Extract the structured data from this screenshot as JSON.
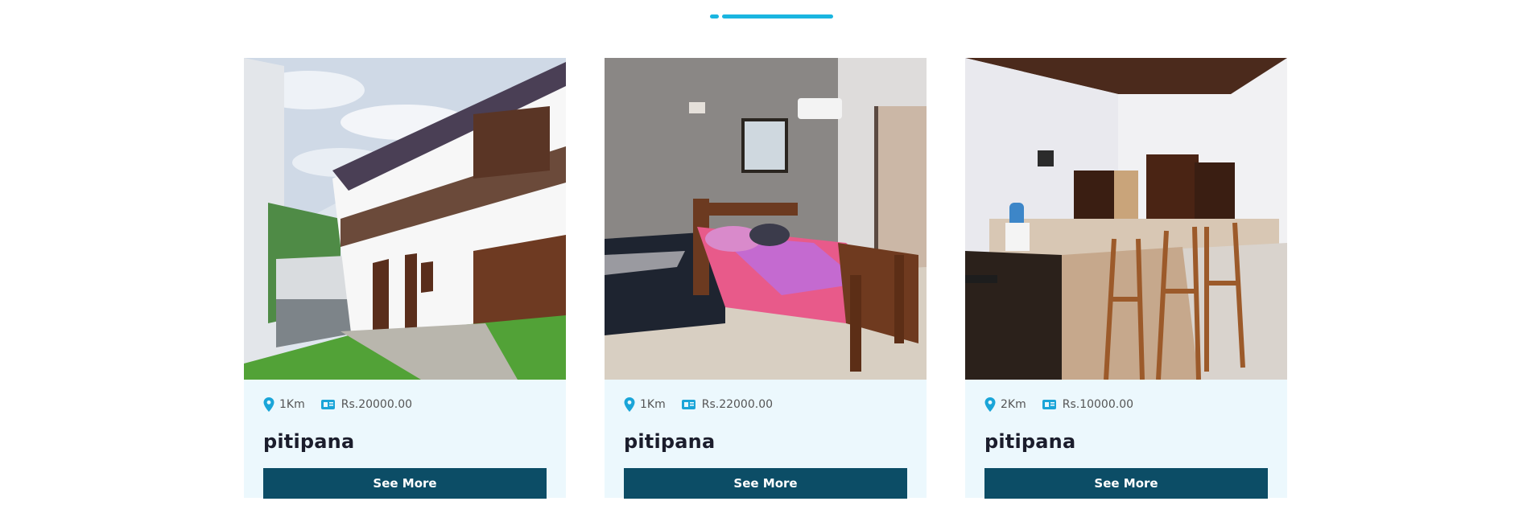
{
  "section": {
    "accent_color": "#1ab5e0"
  },
  "listings": [
    {
      "distance": "1Km",
      "price": "Rs.20000.00",
      "name": "pitipana",
      "button_label": "See More",
      "image": "two-story-house-exterior"
    },
    {
      "distance": "1Km",
      "price": "Rs.22000.00",
      "name": "pitipana",
      "button_label": "See More",
      "image": "bedroom-interior"
    },
    {
      "distance": "2Km",
      "price": "Rs.10000.00",
      "name": "pitipana",
      "button_label": "See More",
      "image": "kitchen-bar-interior"
    }
  ],
  "colors": {
    "card_bg": "#ecf8fd",
    "button_bg": "#0c4d66",
    "icon": "#1aa5d8",
    "title": "#1b1d2c"
  }
}
